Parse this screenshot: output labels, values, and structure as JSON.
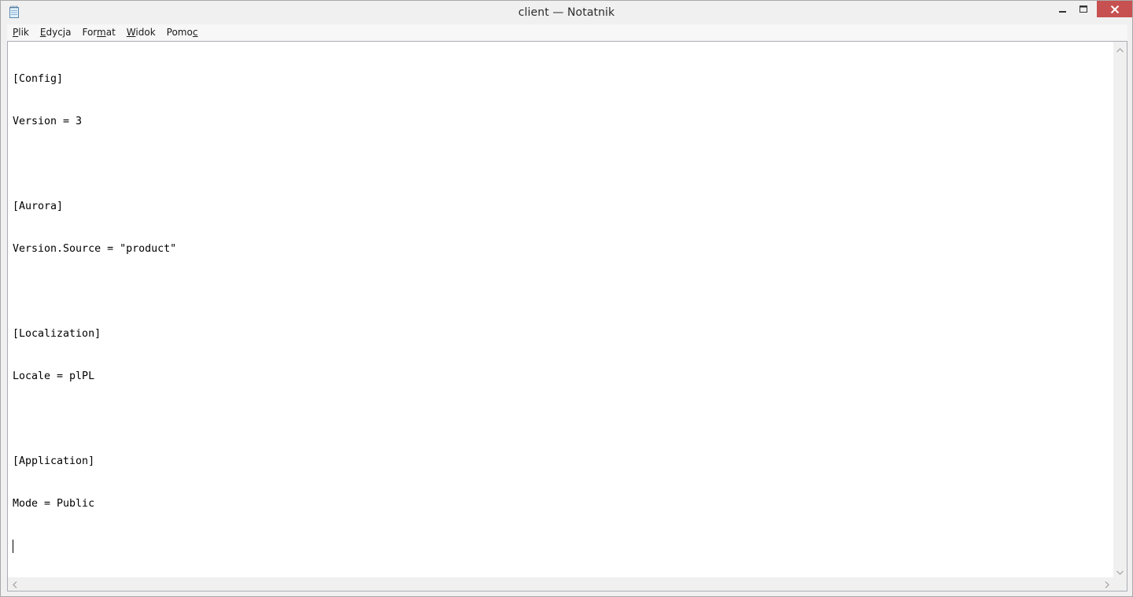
{
  "window": {
    "title": "client — Notatnik"
  },
  "icons": {
    "app": "notepad-icon",
    "minimize": "minimize-icon",
    "maximize": "maximize-icon",
    "close": "close-icon"
  },
  "colors": {
    "close_button": "#c75050",
    "editor_background": "#ffffff",
    "chrome": "#f0f0f0"
  },
  "menu": {
    "items": [
      {
        "pre": "",
        "acc": "P",
        "post": "lik"
      },
      {
        "pre": "",
        "acc": "E",
        "post": "dycja"
      },
      {
        "pre": "For",
        "acc": "m",
        "post": "at"
      },
      {
        "pre": "",
        "acc": "W",
        "post": "idok"
      },
      {
        "pre": "Pomo",
        "acc": "c",
        "post": ""
      }
    ]
  },
  "document": {
    "lines": [
      "[Config]",
      "Version = 3",
      "",
      "[Aurora]",
      "Version.Source = \"product\"",
      "",
      "[Localization]",
      "Locale = plPL",
      "",
      "[Application]",
      "Mode = Public",
      ""
    ]
  }
}
